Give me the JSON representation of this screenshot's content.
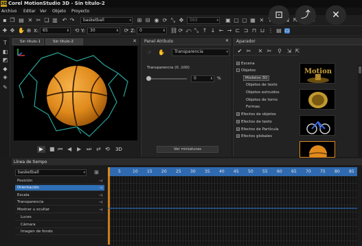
{
  "app": {
    "title": "Corel MotionStudio 3D - Sin título-2",
    "logo": "3D"
  },
  "menu": [
    "Archivo",
    "Editar",
    "Ver",
    "Objeto",
    "Proyecto"
  ],
  "toolbar": {
    "object_select": "basketball",
    "number_field": "563",
    "x_label": "X:",
    "x_value": "65",
    "y_label": "Y:",
    "y_value": "30",
    "z_label": "Z:",
    "z_value": "0"
  },
  "viewport": {
    "tabs": [
      "Sin título-1",
      "Sin título-2"
    ],
    "controls_3d": "3D"
  },
  "attribute_panel": {
    "title": "Panel Atributo",
    "dropdown": "Transparencia",
    "slider_label": "Transparencia (0..100)",
    "slider_value": "0",
    "unit": "%",
    "thumbs_button": "Ver miniaturas"
  },
  "library": {
    "title": "Aparador",
    "tree": [
      {
        "label": "Escena",
        "expand": "+"
      },
      {
        "label": "Objetos",
        "expand": "-"
      },
      {
        "label": "Modelos 3D",
        "child": true
      },
      {
        "label": "Objetos de texto",
        "child": true
      },
      {
        "label": "Objetos extruidos",
        "child": true
      },
      {
        "label": "Objetos de torno",
        "child": true
      },
      {
        "label": "Formas",
        "child": true
      },
      {
        "label": "Efectos de objetos",
        "expand": "+"
      },
      {
        "label": "Efectos de texto",
        "expand": "+"
      },
      {
        "label": "Efectos de Partícula",
        "expand": "+"
      },
      {
        "label": "Efectos globales",
        "expand": "+"
      }
    ],
    "thumb_text": "Motion"
  },
  "timeline": {
    "title": "Línea de tiempo",
    "object": "basketball",
    "tracks": [
      {
        "label": "Posición",
        "selected": false
      },
      {
        "label": "Orientación",
        "selected": true
      },
      {
        "label": "Escala",
        "selected": false
      },
      {
        "label": "Transparencia",
        "selected": false
      },
      {
        "label": "Mostrar u ocultar",
        "selected": false
      },
      {
        "label": "Luces",
        "selected": false
      },
      {
        "label": "Cámara",
        "selected": false
      },
      {
        "label": "Imagen de fondo",
        "selected": false
      }
    ],
    "ruler": [
      "5",
      "10",
      "15",
      "20",
      "25",
      "30",
      "35",
      "40",
      "45",
      "50",
      "55",
      "60",
      "65",
      "70",
      "75",
      "80",
      "85"
    ]
  },
  "colors": {
    "accent": "#2f6ab0",
    "selection": "#2f6fb6",
    "ball": "#e08a1c"
  }
}
